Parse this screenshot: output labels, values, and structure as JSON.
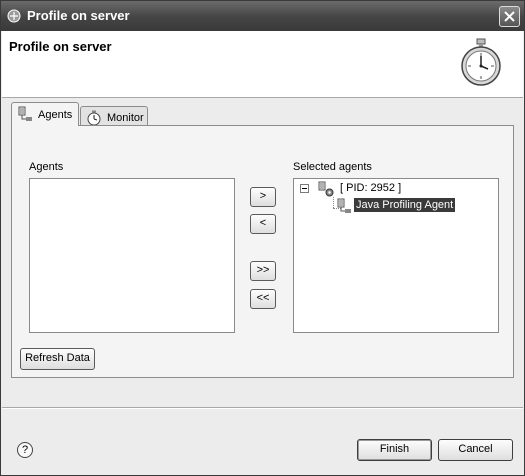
{
  "window": {
    "title": "Profile on server",
    "close_icon": "close-icon"
  },
  "header": {
    "title": "Profile on server",
    "icon": "stopwatch-icon"
  },
  "tabs": [
    {
      "label": "Agents",
      "icon": "agents-icon",
      "selected": true
    },
    {
      "label": "Monitor",
      "icon": "monitor-icon",
      "selected": false
    }
  ],
  "agents_panel": {
    "agents_label": "Agents",
    "selected_label": "Selected agents",
    "agents_items": [],
    "buttons": {
      "add": ">",
      "remove": "<",
      "add_all": ">>",
      "remove_all": "<<"
    },
    "tree": {
      "process_label": "[ PID: 2952 ]",
      "agent_label": "Java Profiling Agent"
    },
    "refresh_label": "Refresh Data"
  },
  "footer": {
    "help": "?",
    "finish_label": "Finish",
    "cancel_label": "Cancel"
  }
}
